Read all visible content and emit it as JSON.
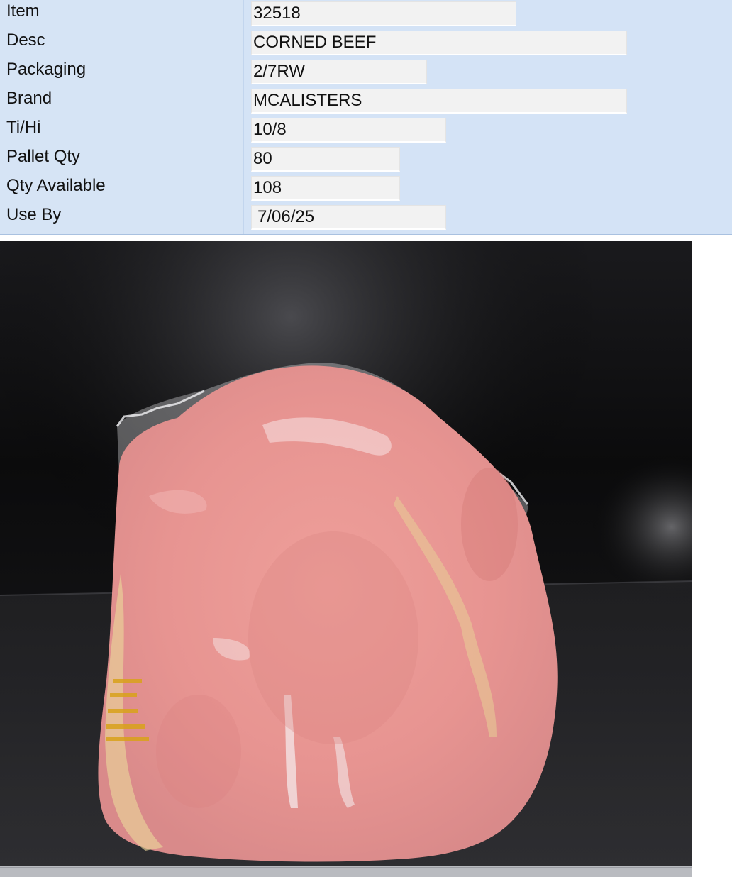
{
  "fields": [
    {
      "label": "Item",
      "value": "32518"
    },
    {
      "label": "Desc",
      "value": "CORNED BEEF"
    },
    {
      "label": "Packaging",
      "value": "2/7RW"
    },
    {
      "label": "Brand",
      "value": "MCALISTERS"
    },
    {
      "label": "Ti/Hi",
      "value": "10/8"
    },
    {
      "label": "Pallet Qty",
      "value": "80"
    },
    {
      "label": "Qty Available",
      "value": "108"
    },
    {
      "label": "Use By",
      "value": "7/06/25"
    }
  ],
  "colors": {
    "panel_background": "#d4e3f6",
    "field_background": "#f2f2f2",
    "photo_backdrop": "#0d0d0f",
    "meat": "#e59a98"
  }
}
